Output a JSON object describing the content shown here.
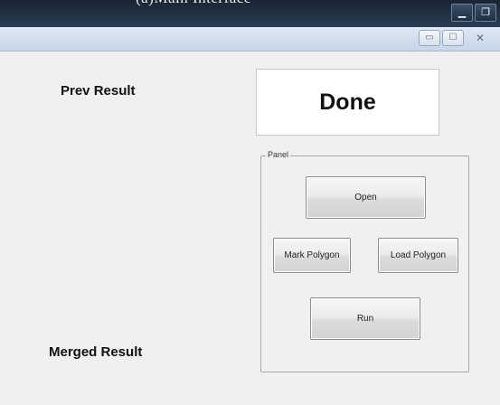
{
  "outer_window": {
    "title_fragment": "(a)Main Interface",
    "minimize_glyph": "▁",
    "maximize_glyph": "❐"
  },
  "inner_window": {
    "minimize_glyph": "▭",
    "maximize_glyph": "☐",
    "close_glyph": "✕"
  },
  "labels": {
    "prev_result": "Prev Result",
    "merged_result": "Merged Result"
  },
  "status_display": {
    "text": "Done"
  },
  "panel": {
    "title": "Panel",
    "buttons": {
      "open": "Open",
      "mark_polygon": "Mark Polygon",
      "load_polygon": "Load Polygon",
      "run": "Run"
    }
  }
}
